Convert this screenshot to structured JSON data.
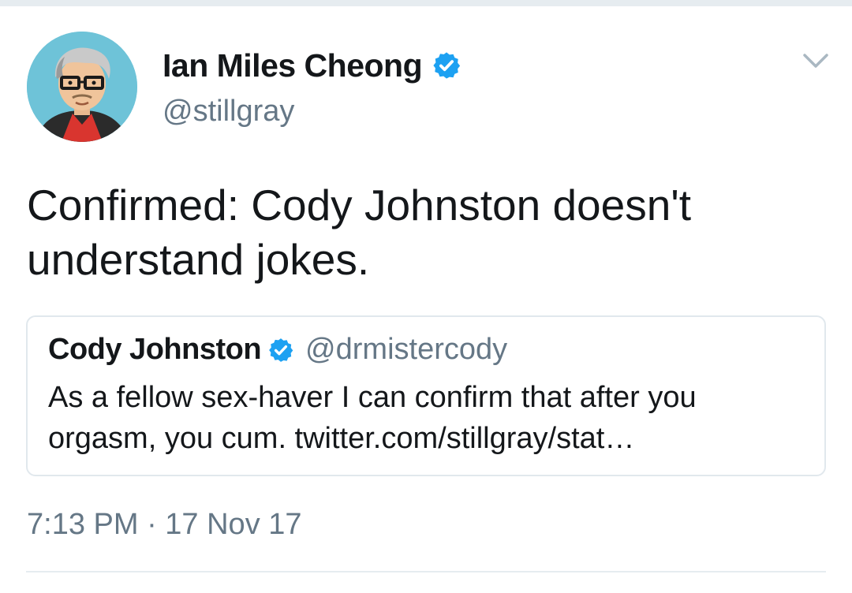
{
  "tweet": {
    "author": {
      "name": "Ian Miles Cheong",
      "handle": "@stillgray",
      "verified": true
    },
    "text": "Confirmed: Cody Johnston doesn't understand jokes.",
    "quoted_tweet": {
      "name": "Cody Johnston",
      "handle": "@drmistercody",
      "verified": true,
      "text": "As a fellow sex-haver I can confirm that after you orgasm, you cum. twitter.com/stillgray/stat…"
    },
    "timestamp": "7:13 PM · 17 Nov 17"
  },
  "icons": {
    "avatar": "avatar-cartoon-portrait",
    "verified": "verified-badge-icon",
    "menu": "chevron-down-icon"
  },
  "colors": {
    "verified_blue": "#1da1f2",
    "secondary_text": "#657786",
    "border": "#e1e8ed",
    "avatar_bg": "#6ec3d8"
  }
}
